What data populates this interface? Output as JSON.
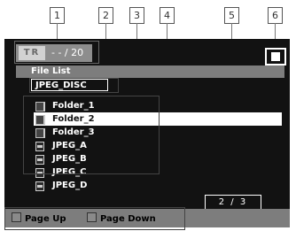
{
  "callouts": [
    "1",
    "2",
    "3",
    "4",
    "5",
    "6"
  ],
  "indicator": {
    "label": "TR",
    "track": "- - / 20"
  },
  "header": {
    "title": "File List",
    "disc": "JPEG_DISC"
  },
  "items": [
    {
      "label": "Folder_1",
      "icon": "folder-icon",
      "selected": false
    },
    {
      "label": "Folder_2",
      "icon": "folder-icon",
      "selected": true
    },
    {
      "label": "Folder_3",
      "icon": "folder-icon",
      "selected": false
    },
    {
      "label": "JPEG_A",
      "icon": "image-file-icon",
      "selected": false
    },
    {
      "label": "JPEG_B",
      "icon": "image-file-icon",
      "selected": false
    },
    {
      "label": "JPEG_C",
      "icon": "image-file-icon",
      "selected": false
    },
    {
      "label": "JPEG_D",
      "icon": "image-file-icon",
      "selected": false
    }
  ],
  "page_counter": "2 / 3",
  "footer": {
    "page_up": "Page Up",
    "page_down": "Page Down"
  },
  "colors": {
    "screen_bg": "#121212",
    "bar_gray": "#7d7d7d",
    "highlight": "#ffffff"
  }
}
